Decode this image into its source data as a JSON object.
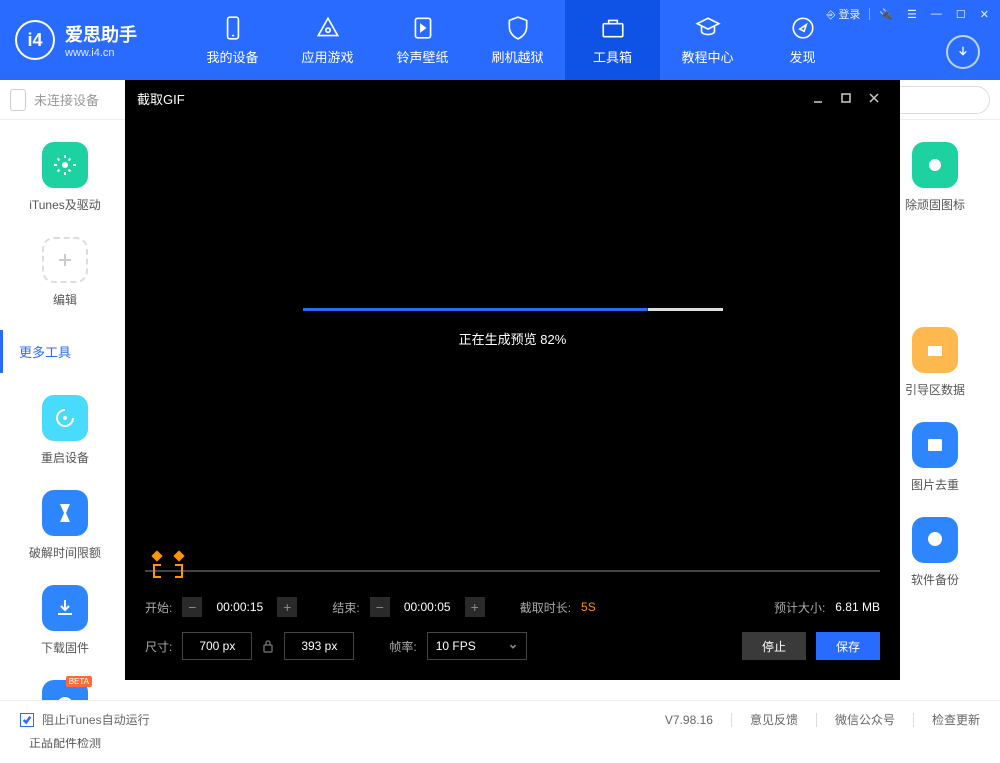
{
  "header": {
    "logo_title": "爱思助手",
    "logo_url": "www.i4.cn",
    "login": "登录",
    "nav": [
      {
        "label": "我的设备",
        "icon": "device"
      },
      {
        "label": "应用游戏",
        "icon": "apps"
      },
      {
        "label": "铃声壁纸",
        "icon": "music"
      },
      {
        "label": "刷机越狱",
        "icon": "shield"
      },
      {
        "label": "工具箱",
        "icon": "toolbox",
        "active": true
      },
      {
        "label": "教程中心",
        "icon": "book"
      },
      {
        "label": "发现",
        "icon": "compass"
      }
    ]
  },
  "subbar": {
    "no_device": "未连接设备"
  },
  "sidebar_left": {
    "section_label": "更多工具",
    "items": [
      {
        "label": "iTunes及驱动",
        "color": "#1dd1a1",
        "icon": "gear"
      },
      {
        "label": "编辑",
        "color": "",
        "icon": "plus"
      },
      {
        "label": "重启设备",
        "color": "#48dbfb",
        "icon": "restart"
      },
      {
        "label": "破解时间限额",
        "color": "#2e86ff",
        "icon": "hourglass"
      },
      {
        "label": "下载固件",
        "color": "#2e86ff",
        "icon": "download"
      },
      {
        "label": "正品配件检测",
        "color": "#2e86ff",
        "icon": "headphones",
        "beta": "BETA"
      }
    ]
  },
  "sidebar_right": {
    "items": [
      {
        "label": "除顽固图标",
        "color": "#1dd1a1",
        "icon": "clean"
      },
      {
        "label": "引导区数据",
        "color": "#ffb84d",
        "icon": "folder"
      },
      {
        "label": "图片去重",
        "color": "#2e86ff",
        "icon": "image"
      },
      {
        "label": "软件备份",
        "color": "#2e86ff",
        "icon": "chat"
      }
    ]
  },
  "modal": {
    "title": "截取GIF",
    "progress_percent": 82,
    "progress_text": "正在生成预览 82%",
    "start_label": "开始:",
    "start_time": "00:00:15",
    "end_label": "结束:",
    "end_time": "00:00:05",
    "duration_label": "截取时长:",
    "duration_value": "5S",
    "est_label": "预计大小:",
    "est_value": "6.81 MB",
    "size_label": "尺寸:",
    "width": "700 px",
    "height": "393 px",
    "fps_label": "帧率:",
    "fps_value": "10 FPS",
    "stop_btn": "停止",
    "save_btn": "保存"
  },
  "footer": {
    "checkbox_label": "阻止iTunes自动运行",
    "version": "V7.98.16",
    "links": [
      "意见反馈",
      "微信公众号",
      "检查更新"
    ]
  }
}
